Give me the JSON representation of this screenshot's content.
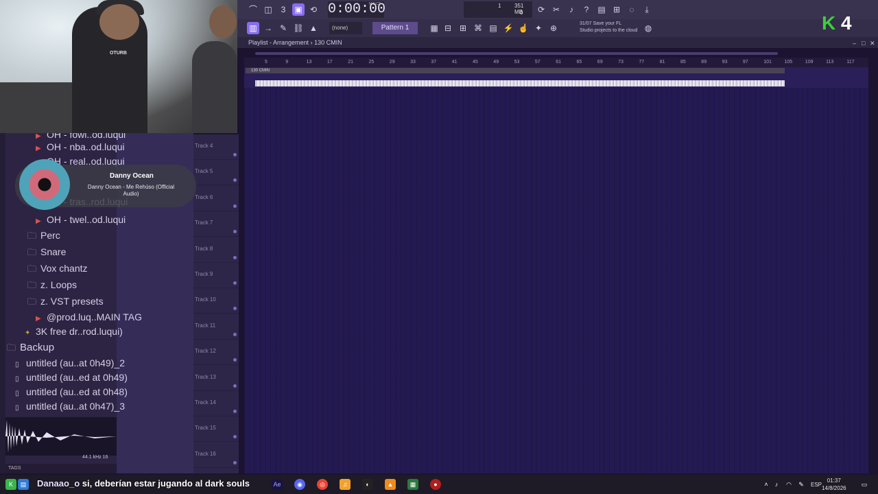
{
  "webcam": {
    "shirt_text": "OTURB"
  },
  "toolbar": {
    "time": "0:00:00",
    "time_unit": "M:S:CS",
    "mem": "351 MB",
    "cpu_top": "1",
    "cpu_bottom": "0",
    "none_select": "(none)",
    "pattern": "Pattern 1",
    "cloud_date": "31/07",
    "cloud_line1": "Save your FL",
    "cloud_line2": "Studio projects to the cloud"
  },
  "overlay": {
    "k_logo": "K",
    "k_number": "4"
  },
  "playlist": {
    "title": "Playlist - Arrangement",
    "sep": "›",
    "tempo_marker": "130 CMIN",
    "tempo_strip": "130 CMIN"
  },
  "ruler": [
    "5",
    "9",
    "13",
    "17",
    "21",
    "25",
    "29",
    "33",
    "37",
    "41",
    "45",
    "49",
    "53",
    "57",
    "61",
    "65",
    "69",
    "73",
    "77",
    "81",
    "85",
    "89",
    "93",
    "97",
    "101",
    "105",
    "109",
    "113",
    "117"
  ],
  "tracks": [
    "Track 4",
    "Track 5",
    "Track 6",
    "Track 7",
    "Track 8",
    "Track 9",
    "Track 10",
    "Track 11",
    "Track 12",
    "Track 13",
    "Track 14",
    "Track 15",
    "Track 16"
  ],
  "browser": {
    "items": [
      {
        "label": "OH - fowl..od.luqui",
        "type": "file"
      },
      {
        "label": "OH - nba..od.luqui",
        "type": "file"
      },
      {
        "label": "OH - real..od.luqui",
        "type": "file"
      },
      {
        "label": "OH - tras..rod.luqui",
        "type": "file"
      },
      {
        "label": "OH - twel..od.luqui",
        "type": "file"
      },
      {
        "label": "Perc",
        "type": "folder"
      },
      {
        "label": "Snare",
        "type": "folder"
      },
      {
        "label": "Vox chantz",
        "type": "folder"
      },
      {
        "label": "z. Loops",
        "type": "folder"
      },
      {
        "label": "z. VST presets",
        "type": "folder"
      },
      {
        "label": "@prod.luq..MAIN TAG",
        "type": "file"
      },
      {
        "label": "3K free dr..rod.luqui)",
        "type": "plugin"
      },
      {
        "label": "Backup",
        "type": "root"
      },
      {
        "label": "untitled (au..at 0h49)_2",
        "type": "doc"
      },
      {
        "label": "untitled (au..ed at 0h49)",
        "type": "doc"
      },
      {
        "label": "untitled (au..ed at 0h48)",
        "type": "doc"
      },
      {
        "label": "untitled (au..at 0h47)_3",
        "type": "doc"
      }
    ],
    "wave_info": "44.1 kHz 16",
    "tags": "TAGS"
  },
  "now_playing": {
    "artist": "Danny Ocean",
    "track": "Danny Ocean - Me Rehúso (Official Audio)"
  },
  "chat": {
    "user": "Danaao_o",
    "message": " si, deberían estar jugando al dark souls"
  },
  "taskbar": {
    "lang": "ESP",
    "time": "01:37",
    "date": "14/8/2026"
  },
  "colors": {
    "grid": "#241a52",
    "accent": "#8a6cf0",
    "toolbar": "#3a3350",
    "k_green": "#3ccf3c"
  }
}
